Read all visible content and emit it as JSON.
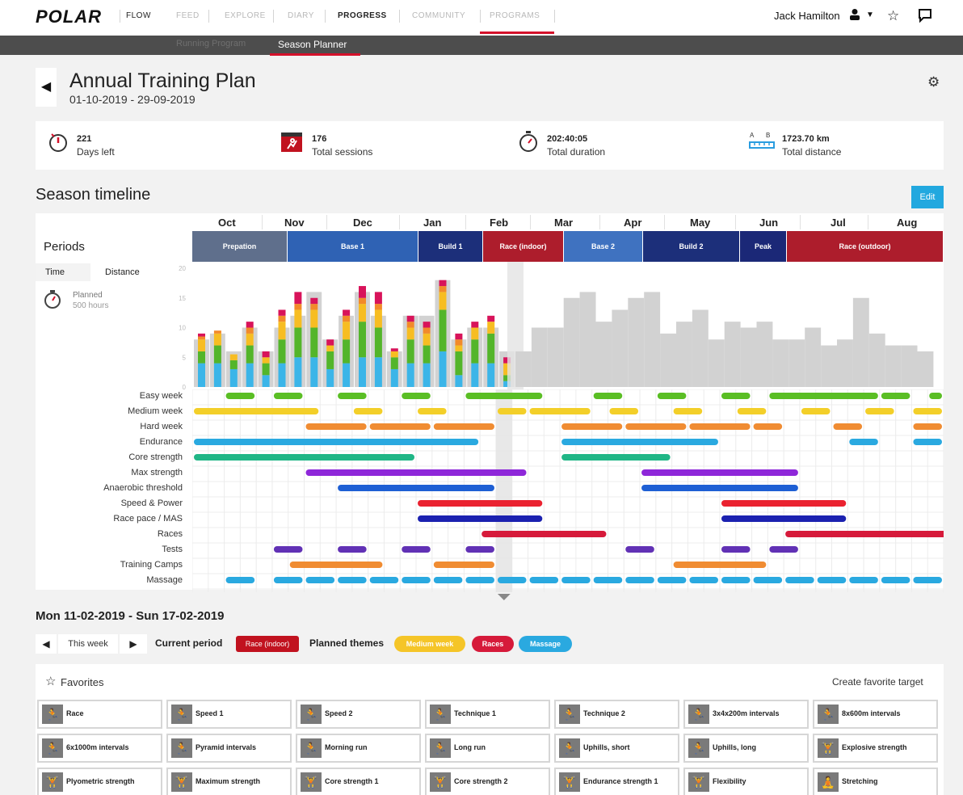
{
  "nav": {
    "logo": "POLAR",
    "brand_suffix": "FLOW",
    "items": [
      {
        "label": "FEED",
        "active": false
      },
      {
        "label": "EXPLORE",
        "active": false
      },
      {
        "label": "DIARY",
        "active": false
      },
      {
        "label": "PROGRESS",
        "active": true
      },
      {
        "label": "COMMUNITY",
        "active": false
      },
      {
        "label": "PROGRAMS",
        "active": false
      }
    ],
    "user_name": "Jack Hamilton",
    "icons": [
      "user-icon",
      "chevron-down-icon",
      "star-icon",
      "message-icon"
    ]
  },
  "subnav": {
    "items": [
      {
        "label": "Running Program",
        "active": false
      },
      {
        "label": "Season Planner",
        "active": true
      }
    ]
  },
  "header": {
    "title": "Annual Training Plan",
    "dates": "01-10-2019 - 29-09-2019",
    "accent": "#d4112a"
  },
  "stats": [
    {
      "icon": "countdown-icon",
      "value": "221",
      "label": "Days left"
    },
    {
      "icon": "runner-calendar-icon",
      "value": "176",
      "label": "Total sessions"
    },
    {
      "icon": "stopwatch-icon",
      "value": "202:40:05",
      "label": "Total duration"
    },
    {
      "icon": "route-icon",
      "value": "1723.70 km",
      "label": "Total distance"
    }
  ],
  "timeline": {
    "title": "Season timeline",
    "edit_label": "Edit",
    "periods_label": "Periods",
    "tabs": [
      {
        "label": "Time",
        "active": true
      },
      {
        "label": "Distance",
        "active": false
      }
    ],
    "planned_label": "Planned",
    "planned_value": "500 hours",
    "months": [
      "Oct",
      "Nov",
      "Dec",
      "Jan",
      "Feb",
      "Mar",
      "Apr",
      "May",
      "Jun",
      "Jul",
      "Aug"
    ],
    "periods": [
      {
        "label": "Prepation",
        "color": "#5f6f8c"
      },
      {
        "label": "Base 1",
        "color": "#2f62b4"
      },
      {
        "label": "Build 1",
        "color": "#1c2f7a"
      },
      {
        "label": "Race (indoor)",
        "color": "#ad1d2c"
      },
      {
        "label": "Base 2",
        "color": "#3f72c0"
      },
      {
        "label": "Build 2",
        "color": "#1c2f7a"
      },
      {
        "label": "Peak",
        "color": "#1b2877"
      },
      {
        "label": "Race (outdoor)",
        "color": "#ad1d2c"
      }
    ],
    "theme_labels": [
      "Easy week",
      "Medium week",
      "Hard week",
      "Endurance",
      "Core strength",
      "Max strength",
      "Anaerobic threshold",
      "Speed & Power",
      "Race pace / MAS",
      "Races",
      "Tests",
      "Training Camps",
      "Massage"
    ]
  },
  "chart_data": {
    "type": "bar",
    "ylim": [
      0,
      20
    ],
    "yticks": [
      0,
      5,
      10,
      15,
      20
    ],
    "series_colors": {
      "blue": "#3bb5e8",
      "green": "#53b52a",
      "yellow": "#f7bd22",
      "orange": "#f28a2a",
      "red": "#d8135a",
      "planned": "#d2d2d2"
    },
    "completed_weeks": [
      {
        "planned": 8,
        "segs": [
          4,
          2,
          2,
          0.5,
          0.5
        ]
      },
      {
        "planned": 9,
        "segs": [
          4,
          3,
          2,
          0.5,
          0
        ]
      },
      {
        "planned": 6,
        "segs": [
          3,
          1.5,
          1,
          0,
          0
        ]
      },
      {
        "planned": 10,
        "segs": [
          4,
          3,
          2,
          1,
          1
        ]
      },
      {
        "planned": 6,
        "segs": [
          2,
          2,
          1,
          0,
          1
        ]
      },
      {
        "planned": 10,
        "segs": [
          4,
          4,
          3,
          1,
          1
        ]
      },
      {
        "planned": 12,
        "segs": [
          5,
          5,
          3,
          1,
          2
        ]
      },
      {
        "planned": 16,
        "segs": [
          5,
          5,
          3,
          1,
          1
        ]
      },
      {
        "planned": 8,
        "segs": [
          3,
          3,
          1,
          0,
          1
        ]
      },
      {
        "planned": 12,
        "segs": [
          4,
          4,
          3,
          1,
          1
        ]
      },
      {
        "planned": 16,
        "segs": [
          5,
          6,
          3,
          1,
          2
        ]
      },
      {
        "planned": 12,
        "segs": [
          5,
          5,
          3,
          1,
          2
        ]
      },
      {
        "planned": 6,
        "segs": [
          3,
          2,
          1,
          0,
          0.5
        ]
      },
      {
        "planned": 12,
        "segs": [
          4,
          4,
          2,
          1,
          1
        ]
      },
      {
        "planned": 12,
        "segs": [
          4,
          3,
          2,
          1,
          1
        ]
      },
      {
        "planned": 18,
        "segs": [
          6,
          7,
          3,
          1,
          1
        ]
      },
      {
        "planned": 8,
        "segs": [
          2,
          4,
          1,
          1,
          1
        ]
      },
      {
        "planned": 10,
        "segs": [
          4,
          4,
          2,
          0,
          1
        ]
      },
      {
        "planned": 10,
        "segs": [
          4,
          5,
          2,
          0,
          1
        ]
      },
      {
        "planned": 6,
        "segs": [
          1,
          1,
          2,
          0,
          1
        ]
      }
    ],
    "planned_future": [
      6,
      10,
      10,
      15,
      16,
      11,
      13,
      15,
      16,
      9,
      11,
      13,
      8,
      11,
      10,
      11,
      8,
      8,
      10,
      7,
      8,
      15,
      9,
      7,
      7,
      6
    ]
  },
  "themes": {
    "week_count": 47,
    "rows": [
      {
        "color": "#5abe24",
        "segs": [
          [
            2,
            2
          ],
          [
            5,
            2
          ],
          [
            9,
            2
          ],
          [
            13,
            2
          ],
          [
            17,
            4
          ],
          [
            20,
            2
          ],
          [
            25,
            2
          ],
          [
            29,
            2
          ],
          [
            33,
            2
          ],
          [
            36,
            4
          ],
          [
            39,
            4
          ],
          [
            43,
            2
          ],
          [
            46,
            1
          ]
        ]
      },
      {
        "color": "#f3cf29",
        "segs": [
          [
            0,
            4
          ],
          [
            3,
            4
          ],
          [
            6,
            2
          ],
          [
            10,
            2
          ],
          [
            14,
            2
          ],
          [
            19,
            2
          ],
          [
            21,
            4
          ],
          [
            26,
            2
          ],
          [
            30,
            2
          ],
          [
            34,
            2
          ],
          [
            38,
            2
          ],
          [
            42,
            2
          ],
          [
            45,
            2
          ]
        ]
      },
      {
        "color": "#f08c32",
        "segs": [
          [
            7,
            4
          ],
          [
            11,
            4
          ],
          [
            15,
            4
          ],
          [
            23,
            4
          ],
          [
            27,
            4
          ],
          [
            31,
            4
          ],
          [
            35,
            2
          ],
          [
            40,
            2
          ],
          [
            45,
            2
          ]
        ]
      },
      {
        "color": "#2aa9e0",
        "segs": [
          [
            0,
            18
          ],
          [
            23,
            10
          ],
          [
            41,
            2
          ],
          [
            45,
            2
          ]
        ]
      },
      {
        "color": "#20b686",
        "segs": [
          [
            0,
            14
          ],
          [
            23,
            7
          ]
        ]
      },
      {
        "color": "#8e27d9",
        "segs": [
          [
            7,
            14
          ],
          [
            28,
            10
          ]
        ]
      },
      {
        "color": "#1e5fd4",
        "segs": [
          [
            9,
            10
          ],
          [
            28,
            10
          ]
        ]
      },
      {
        "color": "#ea2230",
        "segs": [
          [
            14,
            8
          ],
          [
            33,
            8
          ]
        ]
      },
      {
        "color": "#1b21b0",
        "segs": [
          [
            14,
            8
          ],
          [
            33,
            8
          ]
        ]
      },
      {
        "color": "#d61a3a",
        "segs": [
          [
            18,
            8
          ],
          [
            37,
            8
          ],
          [
            42,
            6
          ],
          [
            46,
            1
          ]
        ]
      },
      {
        "color": "#6131b5",
        "segs": [
          [
            5,
            2
          ],
          [
            9,
            2
          ],
          [
            13,
            2
          ],
          [
            17,
            2
          ],
          [
            27,
            2
          ],
          [
            33,
            2
          ],
          [
            36,
            2
          ]
        ]
      },
      {
        "color": "#f08c32",
        "segs": [
          [
            6,
            6
          ],
          [
            15,
            4
          ],
          [
            30,
            6
          ]
        ]
      },
      {
        "color": "#2aa9e0",
        "segs": [
          [
            2,
            2
          ],
          [
            5,
            2
          ],
          [
            7,
            2
          ],
          [
            9,
            2
          ],
          [
            11,
            2
          ],
          [
            13,
            2
          ],
          [
            15,
            2
          ],
          [
            17,
            2
          ],
          [
            19,
            2
          ],
          [
            21,
            2
          ],
          [
            23,
            2
          ],
          [
            25,
            2
          ],
          [
            27,
            2
          ],
          [
            29,
            2
          ],
          [
            31,
            2
          ],
          [
            33,
            2
          ],
          [
            35,
            2
          ],
          [
            37,
            2
          ],
          [
            39,
            2
          ],
          [
            41,
            2
          ],
          [
            43,
            2
          ],
          [
            45,
            2
          ]
        ]
      }
    ]
  },
  "week": {
    "range": "Mon 11-02-2019 - Sun 17-02-2019",
    "this_week_label": "This week",
    "current_period_label": "Current period",
    "current_period_value": "Race (indoor)",
    "planned_themes_label": "Planned themes",
    "planned_themes": [
      {
        "label": "Medium week",
        "color": "#f5c528"
      },
      {
        "label": "Races",
        "color": "#d61a3a"
      },
      {
        "label": "Massage",
        "color": "#2aa9e0"
      }
    ]
  },
  "favorites": {
    "title": "Favorites",
    "create_label": "Create favorite target",
    "items": [
      {
        "label": "Race",
        "icon": "runner-icon"
      },
      {
        "label": "Speed 1",
        "icon": "runner-icon"
      },
      {
        "label": "Speed 2",
        "icon": "runner-icon"
      },
      {
        "label": "Technique 1",
        "icon": "runner-icon"
      },
      {
        "label": "Technique 2",
        "icon": "runner-icon"
      },
      {
        "label": "3x4x200m intervals",
        "icon": "runner-icon"
      },
      {
        "label": "8x600m intervals",
        "icon": "runner-icon"
      },
      {
        "label": "6x1000m intervals",
        "icon": "runner-icon"
      },
      {
        "label": "Pyramid intervals",
        "icon": "runner-icon"
      },
      {
        "label": "Morning run",
        "icon": "runner-icon"
      },
      {
        "label": "Long run",
        "icon": "runner-icon"
      },
      {
        "label": "Uphills, short",
        "icon": "runner-icon"
      },
      {
        "label": "Uphills, long",
        "icon": "runner-icon"
      },
      {
        "label": "Explosive strength",
        "icon": "strength-icon"
      },
      {
        "label": "Plyometric strength",
        "icon": "strength-icon"
      },
      {
        "label": "Maximum strength",
        "icon": "strength-icon"
      },
      {
        "label": "Core strength 1",
        "icon": "strength-icon"
      },
      {
        "label": "Core strength 2",
        "icon": "strength-icon"
      },
      {
        "label": "Endurance strength 1",
        "icon": "strength-icon"
      },
      {
        "label": "Flexibility",
        "icon": "strength-icon"
      },
      {
        "label": "Stretching",
        "icon": "stretch-icon"
      }
    ]
  }
}
